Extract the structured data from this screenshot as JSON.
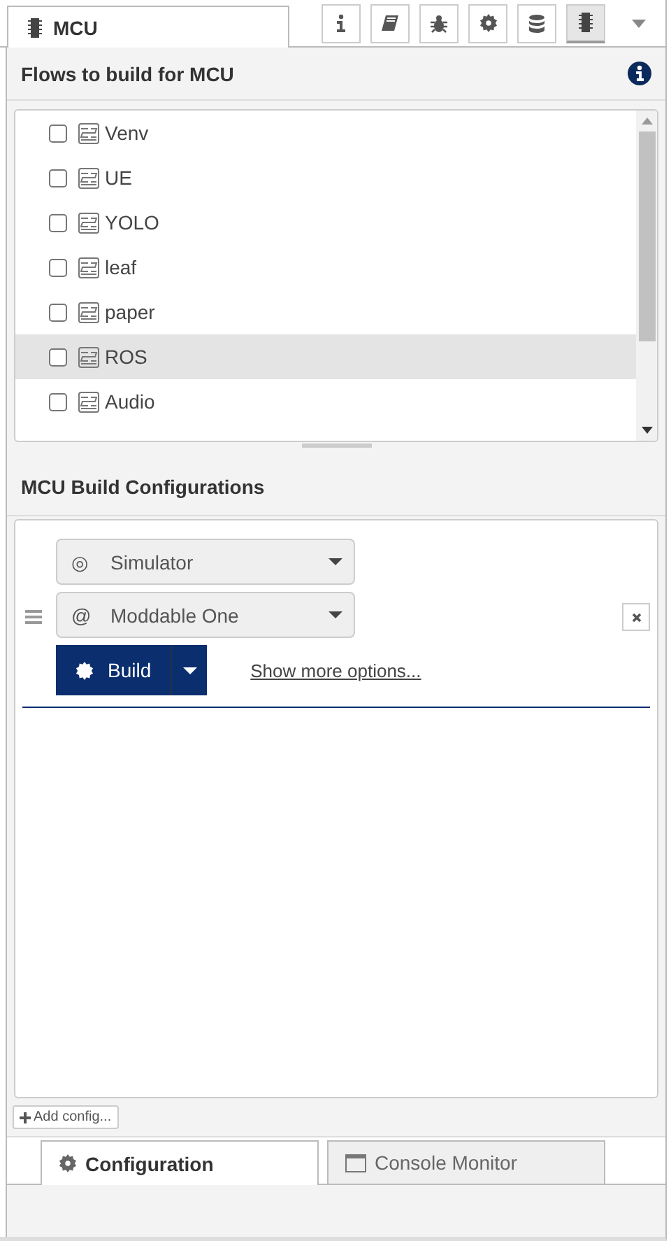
{
  "tab": {
    "label": "MCU"
  },
  "toolbar": [
    {
      "kind": "info",
      "selected": false
    },
    {
      "kind": "book",
      "selected": false
    },
    {
      "kind": "bug",
      "selected": false
    },
    {
      "kind": "gear",
      "selected": false
    },
    {
      "kind": "database",
      "selected": false
    },
    {
      "kind": "chip",
      "selected": true
    }
  ],
  "flows_header": "Flows to build for MCU",
  "flows": [
    {
      "label": "Venv",
      "checked": false,
      "selected": false
    },
    {
      "label": "UE",
      "checked": false,
      "selected": false
    },
    {
      "label": "YOLO",
      "checked": false,
      "selected": false
    },
    {
      "label": "leaf",
      "checked": false,
      "selected": false
    },
    {
      "label": "paper",
      "checked": false,
      "selected": false
    },
    {
      "label": "ROS",
      "checked": false,
      "selected": true
    },
    {
      "label": "Audio",
      "checked": false,
      "selected": false
    }
  ],
  "config_header": "MCU Build Configurations",
  "config": {
    "platform": {
      "icon": "◎",
      "value": "Simulator"
    },
    "device": {
      "icon": "@",
      "value": "Moddable One"
    },
    "build": "Build",
    "more": "Show more options..."
  },
  "add_config": "Add config...",
  "bottom_tabs": [
    {
      "label": "Configuration",
      "kind": "gear",
      "selected": true
    },
    {
      "label": "Console Monitor",
      "kind": "window",
      "selected": false
    }
  ]
}
